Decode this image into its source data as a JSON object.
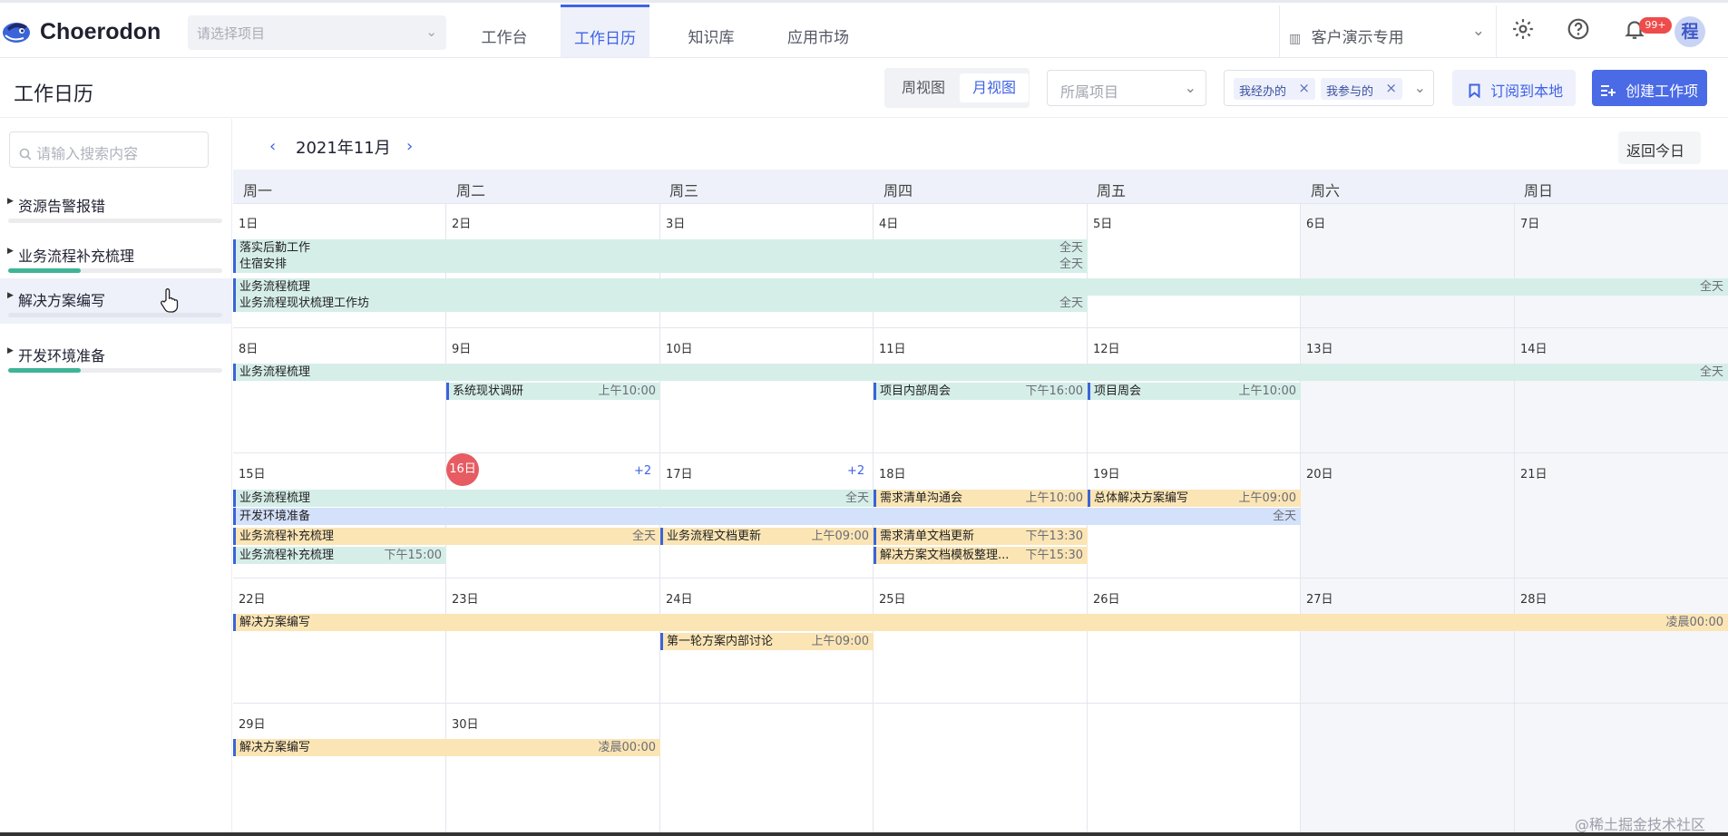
{
  "app": {
    "name": "Choerodon",
    "project_placeholder": "请选择项目",
    "org": "客户演示专用",
    "notif_badge": "99+",
    "avatar_text": "程"
  },
  "nav": {
    "tabs": [
      "工作台",
      "工作日历",
      "知识库",
      "应用市场"
    ],
    "active": 1
  },
  "page": {
    "title": "工作日历",
    "views": [
      "周视图",
      "月视图"
    ],
    "active_view": 1,
    "belong_placeholder": "所属项目",
    "filter_tags": [
      "我经办的",
      "我参与的"
    ],
    "subscribe_label": "订阅到本地",
    "create_label": "创建工作项"
  },
  "sidebar": {
    "search_placeholder": "请输入搜索内容",
    "items": [
      {
        "label": "资源告警报错",
        "progress": 0.0
      },
      {
        "label": "业务流程补充梳理",
        "progress": 0.28
      },
      {
        "label": "解决方案编写",
        "progress": 0.0
      },
      {
        "label": "开发环境准备",
        "progress": 0.28
      }
    ]
  },
  "calendar": {
    "month_label": "2021年11月",
    "today_label": "返回今日",
    "weekdays": [
      "周一",
      "周二",
      "周三",
      "周四",
      "周五",
      "周六",
      "周日"
    ],
    "days": [
      "1日",
      "2日",
      "3日",
      "4日",
      "5日",
      "6日",
      "7日",
      "8日",
      "9日",
      "10日",
      "11日",
      "12日",
      "13日",
      "14日",
      "15日",
      "16日",
      "17日",
      "18日",
      "19日",
      "20日",
      "21日",
      "22日",
      "23日",
      "24日",
      "25日",
      "26日",
      "27日",
      "28日",
      "29日",
      "30日"
    ],
    "today_index": 15,
    "more": [
      {
        "day": "16日",
        "label": "+2"
      },
      {
        "day": "17日",
        "label": "+2"
      }
    ],
    "events": [
      {
        "title": "落实后勤工作",
        "time": "全天"
      },
      {
        "title": "住宿安排",
        "time": "全天"
      },
      {
        "title": "业务流程梳理",
        "time": "全天"
      },
      {
        "title": "业务流程现状梳理工作坊",
        "time": "全天"
      },
      {
        "title": "业务流程梳理",
        "time": "全天"
      },
      {
        "title": "系统现状调研",
        "time": "上午10:00"
      },
      {
        "title": "项目内部周会",
        "time": "下午16:00"
      },
      {
        "title": "项目周会",
        "time": "上午10:00"
      },
      {
        "title": "业务流程梳理",
        "time": "全天"
      },
      {
        "title": "需求清单沟通会",
        "time": "上午10:00"
      },
      {
        "title": "总体解决方案编写",
        "time": "上午09:00"
      },
      {
        "title": "开发环境准备",
        "time": "全天"
      },
      {
        "title": "业务流程补充梳理",
        "time": "全天"
      },
      {
        "title": "业务流程文档更新",
        "time": "上午09:00"
      },
      {
        "title": "需求清单文档更新",
        "time": "下午13:30"
      },
      {
        "title": "业务流程补充梳理",
        "time": "下午15:00"
      },
      {
        "title": "解决方案文档模板整理...",
        "time": "下午15:30"
      },
      {
        "title": "解决方案编写",
        "time": "凌晨00:00"
      },
      {
        "title": "第一轮方案内部讨论",
        "time": "上午09:00"
      },
      {
        "title": "解决方案编写",
        "time": "凌晨00:00"
      }
    ]
  },
  "watermark": "@稀土掘金技术社区",
  "colors": {
    "accent": "#3f62e6",
    "today": "#e65c62",
    "teal_event": "#d6eee8",
    "amber_event": "#fbe5b5",
    "blue_event": "#d4e1fb",
    "progress": "#3fb497"
  },
  "icons": [
    "chevron-down-icon",
    "building-icon",
    "gear-icon",
    "help-icon",
    "bell-icon",
    "search-icon",
    "bookmark-icon",
    "create-icon",
    "chevron-left-icon",
    "chevron-right-icon",
    "close-icon"
  ]
}
